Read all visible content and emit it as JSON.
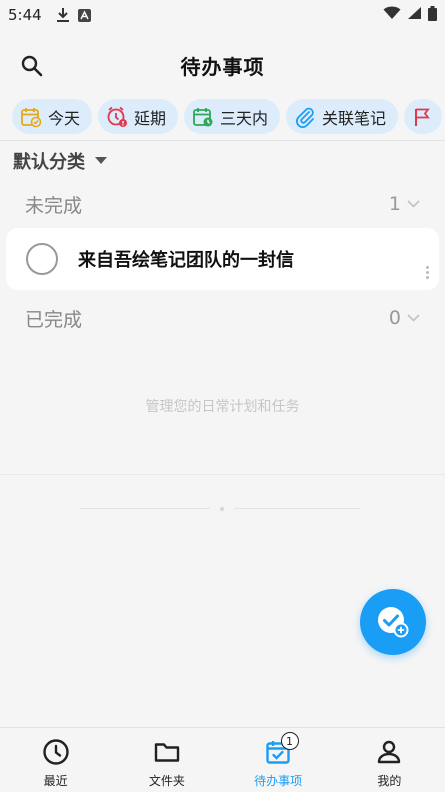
{
  "status_bar": {
    "time": "5:44"
  },
  "header": {
    "title": "待办事项"
  },
  "filters": [
    {
      "label": "今天"
    },
    {
      "label": "延期"
    },
    {
      "label": "三天内"
    },
    {
      "label": "关联笔记"
    }
  ],
  "category": {
    "label": "默认分类"
  },
  "sections": {
    "incomplete": {
      "label": "未完成",
      "count": "1"
    },
    "completed": {
      "label": "已完成",
      "count": "0"
    }
  },
  "tasks": [
    {
      "title": "来自吾绘笔记团队的一封信"
    }
  ],
  "empty_hint": "管理您的日常计划和任务",
  "bottom_nav": [
    {
      "label": "最近"
    },
    {
      "label": "文件夹"
    },
    {
      "label": "待办事项",
      "badge": "1"
    },
    {
      "label": "我的"
    }
  ],
  "colors": {
    "accent": "#1a9ef5",
    "chip_bg": "#dcecfb"
  }
}
